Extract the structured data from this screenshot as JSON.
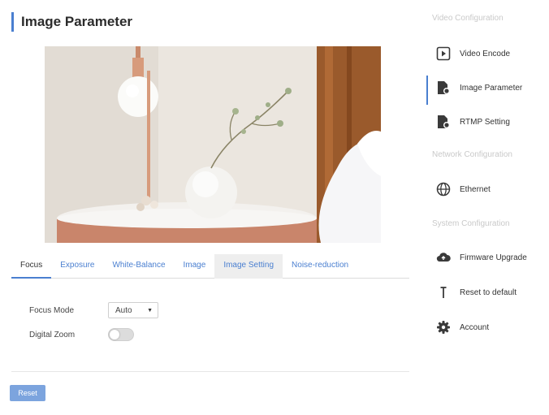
{
  "page": {
    "title": "Image Parameter"
  },
  "tabs": [
    {
      "label": "Focus"
    },
    {
      "label": "Exposure"
    },
    {
      "label": "White-Balance"
    },
    {
      "label": "Image"
    },
    {
      "label": "Image Setting"
    },
    {
      "label": "Noise-reduction"
    }
  ],
  "focus": {
    "focus_mode_label": "Focus Mode",
    "focus_mode_value": "Auto",
    "digital_zoom_label": "Digital Zoom",
    "digital_zoom_on": false
  },
  "reset_label": "Reset",
  "sidebar": {
    "video_header": "Video Configuration",
    "network_header": "Network Configuration",
    "system_header": "System Configuration",
    "items": [
      {
        "label": "Video Encode",
        "icon": "video-encode-icon"
      },
      {
        "label": "Image Parameter",
        "icon": "image-parameter-icon"
      },
      {
        "label": "RTMP Setting",
        "icon": "rtmp-icon"
      },
      {
        "label": "Ethernet",
        "icon": "globe-icon"
      },
      {
        "label": "Firmware Upgrade",
        "icon": "cloud-upload-icon"
      },
      {
        "label": "Reset to default",
        "icon": "reset-icon"
      },
      {
        "label": "Account",
        "icon": "gear-icon"
      }
    ]
  },
  "colors": {
    "accent": "#4a7fd0",
    "button": "#7ca4de"
  }
}
